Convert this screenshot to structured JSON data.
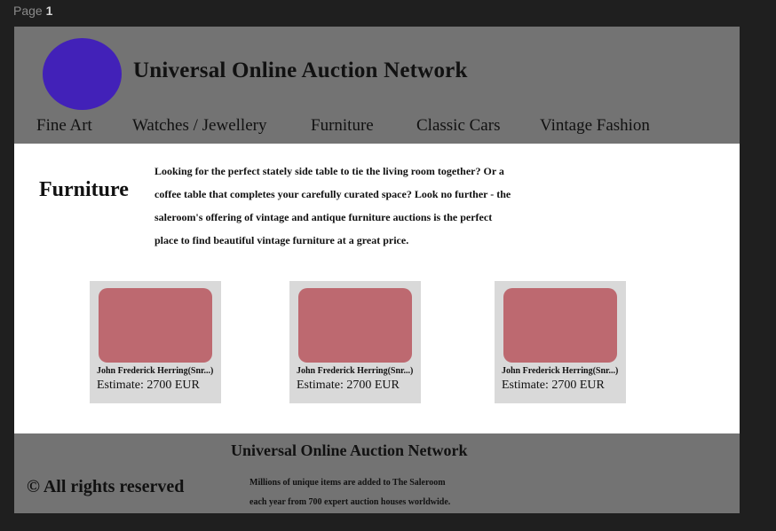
{
  "page_label": {
    "prefix": "Page",
    "number": "1"
  },
  "header": {
    "title": "Universal Online Auction Network",
    "nav": [
      {
        "label": "Fine Art"
      },
      {
        "label": "Watches / Jewellery"
      },
      {
        "label": "Furniture"
      },
      {
        "label": "Classic Cars"
      },
      {
        "label": "Vintage Fashion"
      }
    ]
  },
  "main": {
    "category_title": "Furniture",
    "intro_lines": [
      "Looking for the perfect stately side table to tie the living room together? Or a",
      "coffee table that completes your carefully curated space? Look no further - the",
      "saleroom's offering of vintage and antique furniture auctions is the perfect",
      "place to find beautiful vintage furniture at a great price."
    ],
    "cards": [
      {
        "name": "John Frederick Herring(Snr...)",
        "estimate": "Estimate: 2700 EUR"
      },
      {
        "name": "John Frederick Herring(Snr...)",
        "estimate": "Estimate: 2700 EUR"
      },
      {
        "name": "John Frederick Herring(Snr...)",
        "estimate": "Estimate: 2700 EUR"
      }
    ]
  },
  "footer": {
    "title": "Universal Online Auction Network",
    "copyright": "© All rights reserved",
    "description_lines": [
      "Millions of unique items are added to The Saleroom",
      "each year from 700 expert auction houses worldwide."
    ]
  },
  "colors": {
    "canvas_background": "#1f1f1f",
    "header_footer_background": "#737373",
    "logo": "#4221b8",
    "card_background": "#d9d9d9",
    "card_image_placeholder": "#bd6970"
  }
}
